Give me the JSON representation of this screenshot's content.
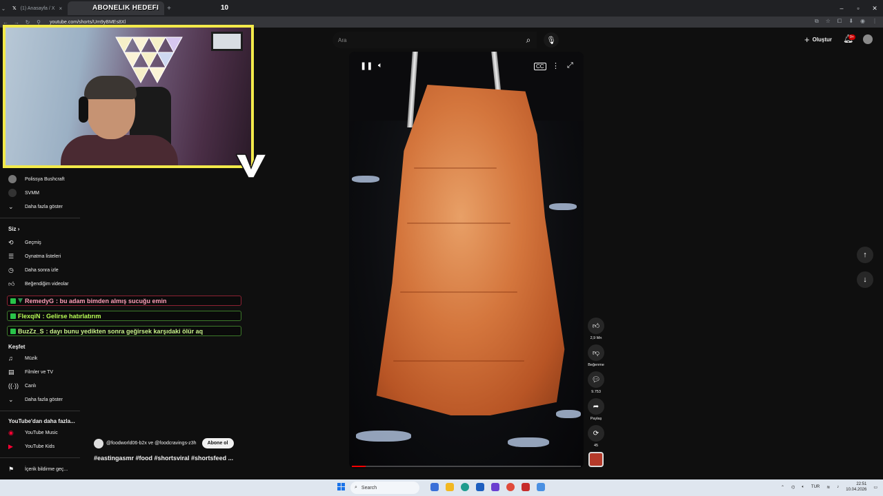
{
  "browser": {
    "tabs": [
      {
        "label": "(1) Anasayfa / X"
      },
      {
        "label": ""
      }
    ],
    "overlay_title": "ABONELIK HEDEFI",
    "overlay_count": "10",
    "url": "youtube.com/shorts/Um9yBMEs8Xl"
  },
  "youtube": {
    "search_placeholder": "Ara",
    "create_label": "Oluştur",
    "notification_count": "9+"
  },
  "sidebar": {
    "subscriptions": [
      {
        "label": "Polissya Bushcraft",
        "icon": "channel-avatar"
      },
      {
        "label": "SVMM",
        "icon": "channel-avatar"
      },
      {
        "label": "Daha fazla göster",
        "icon": "chevron-down-icon"
      }
    ],
    "you_heading": "Siz",
    "you_items": [
      {
        "label": "Geçmiş",
        "icon": "history-icon"
      },
      {
        "label": "Oynatma listeleri",
        "icon": "playlist-icon"
      },
      {
        "label": "Daha sonra izle",
        "icon": "clock-icon"
      },
      {
        "label": "Beğendiğim videolar",
        "icon": "thumbs-up-icon"
      }
    ],
    "explore_heading": "Keşfet",
    "explore_items": [
      {
        "label": "Müzik",
        "icon": "music-icon"
      },
      {
        "label": "Filmler ve TV",
        "icon": "film-icon"
      },
      {
        "label": "Canlı",
        "icon": "live-icon"
      },
      {
        "label": "Daha fazla göster",
        "icon": "chevron-down-icon"
      }
    ],
    "more_heading": "YouTube'dan daha fazla...",
    "more_items": [
      {
        "label": "YouTube Music",
        "icon": "youtube-music-icon"
      },
      {
        "label": "YouTube Kids",
        "icon": "youtube-kids-icon"
      }
    ],
    "report_label": "İçerik bildirme geç..."
  },
  "chat": [
    {
      "user": "RemedyG",
      "text": " : bu adam bimden almış sucuğu emin",
      "color": "#ff9fb8",
      "border": "#8e2233"
    },
    {
      "user": "FlexqiN",
      "text": " : Gelirse hatırlatırım",
      "color": "#b9ff55",
      "border": "#3d7a2a"
    },
    {
      "user": "BuzZz_S",
      "text": " : dayı bunu yedikten sonra geğirsek karşıdaki ölür aq",
      "color": "#c8f28a",
      "border": "#3d7a2a"
    }
  ],
  "video": {
    "progress": 0.06,
    "channel": "@foodworld06-b2x ve @foodcravings-z3h",
    "subscribe_label": "Abone ol",
    "hashtags": "#eastingasmr #food #shortsviral #shortsfeed ..."
  },
  "actions": {
    "likes": "2,9 Mn",
    "dislike_label": "Beğenme",
    "comments": "9.753",
    "share_label": "Paylaş",
    "remix_count": "45"
  },
  "taskbar": {
    "search_label": "Search",
    "lang": "TUR",
    "time": "22:51",
    "date": "10.04.2026"
  },
  "colors": {
    "webcam_border": "#f3ea4a",
    "progress": "#ff0000",
    "background": "#0f0f0f"
  }
}
